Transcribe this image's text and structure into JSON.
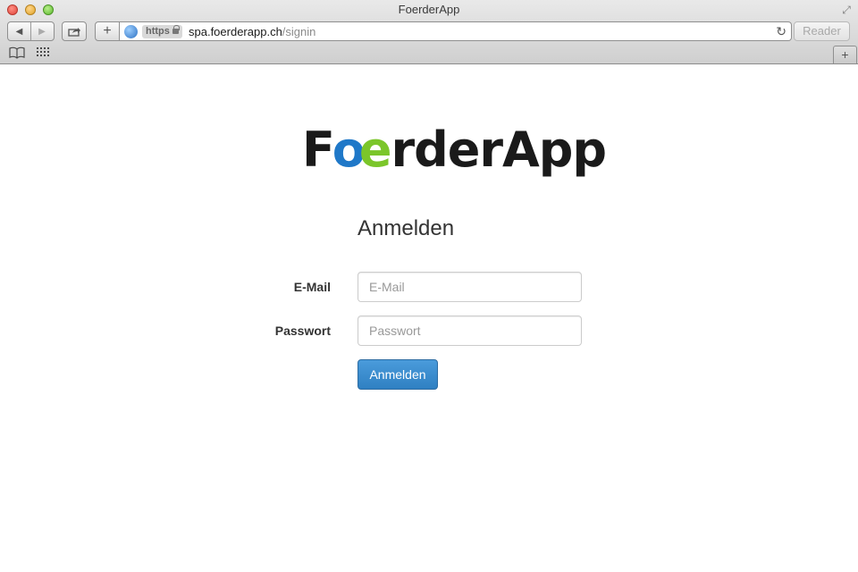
{
  "window": {
    "title": "FoerderApp"
  },
  "toolbar": {
    "scheme": "https",
    "domain": "spa.foerderapp.ch",
    "path": "/signin",
    "reader_label": "Reader",
    "add_label": "+",
    "new_tab_label": "+"
  },
  "page": {
    "logo": {
      "part1": "F",
      "part2": "o",
      "part3": "e",
      "part4": "rderApp"
    },
    "heading": "Anmelden",
    "email_label": "E-Mail",
    "email_placeholder": "E-Mail",
    "password_label": "Passwort",
    "password_placeholder": "Passwort",
    "submit_label": "Anmelden"
  },
  "colors": {
    "logo_blue": "#1f78c8",
    "logo_green": "#7bc62a",
    "button_blue": "#3a8fd0"
  }
}
